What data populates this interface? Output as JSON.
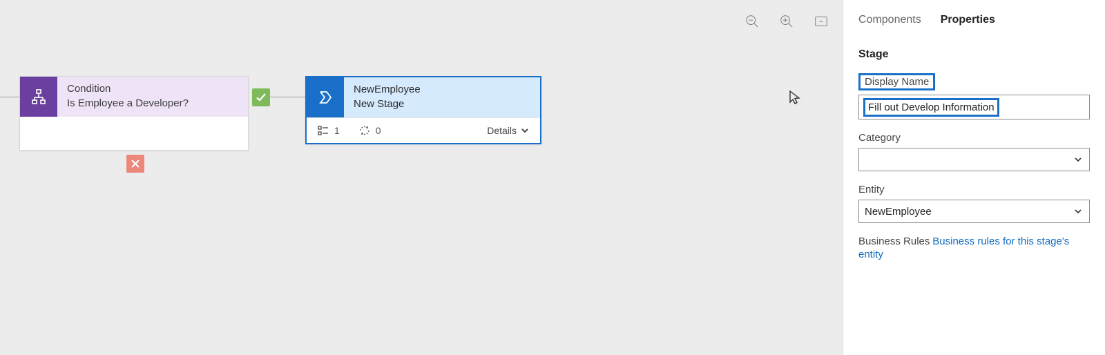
{
  "canvas": {
    "zoom_out_tooltip": "Zoom out",
    "zoom_in_tooltip": "Zoom in",
    "fit_tooltip": "Fit to screen"
  },
  "condition": {
    "type_label": "Condition",
    "title": "Is Employee a Developer?"
  },
  "stage": {
    "entity": "NewEmployee",
    "title": "New Stage",
    "steps_count": "1",
    "processes_count": "0",
    "details_label": "Details"
  },
  "panel": {
    "tab_components": "Components",
    "tab_properties": "Properties",
    "section_title": "Stage",
    "display_name_label": "Display Name",
    "display_name_value": "Fill out Develop Information",
    "category_label": "Category",
    "category_value": "",
    "entity_label": "Entity",
    "entity_value": "NewEmployee",
    "business_rules_label": "Business Rules",
    "business_rules_link": "Business rules for this stage's entity"
  },
  "colors": {
    "condition_icon_bg": "#6b3fa0",
    "condition_head_bg": "#efe4f7",
    "stage_accent": "#1a6fc9",
    "stage_head_bg": "#d6eafd",
    "yes_badge": "#7fba5a",
    "no_badge": "#ec8779",
    "link": "#0f6cbd"
  }
}
